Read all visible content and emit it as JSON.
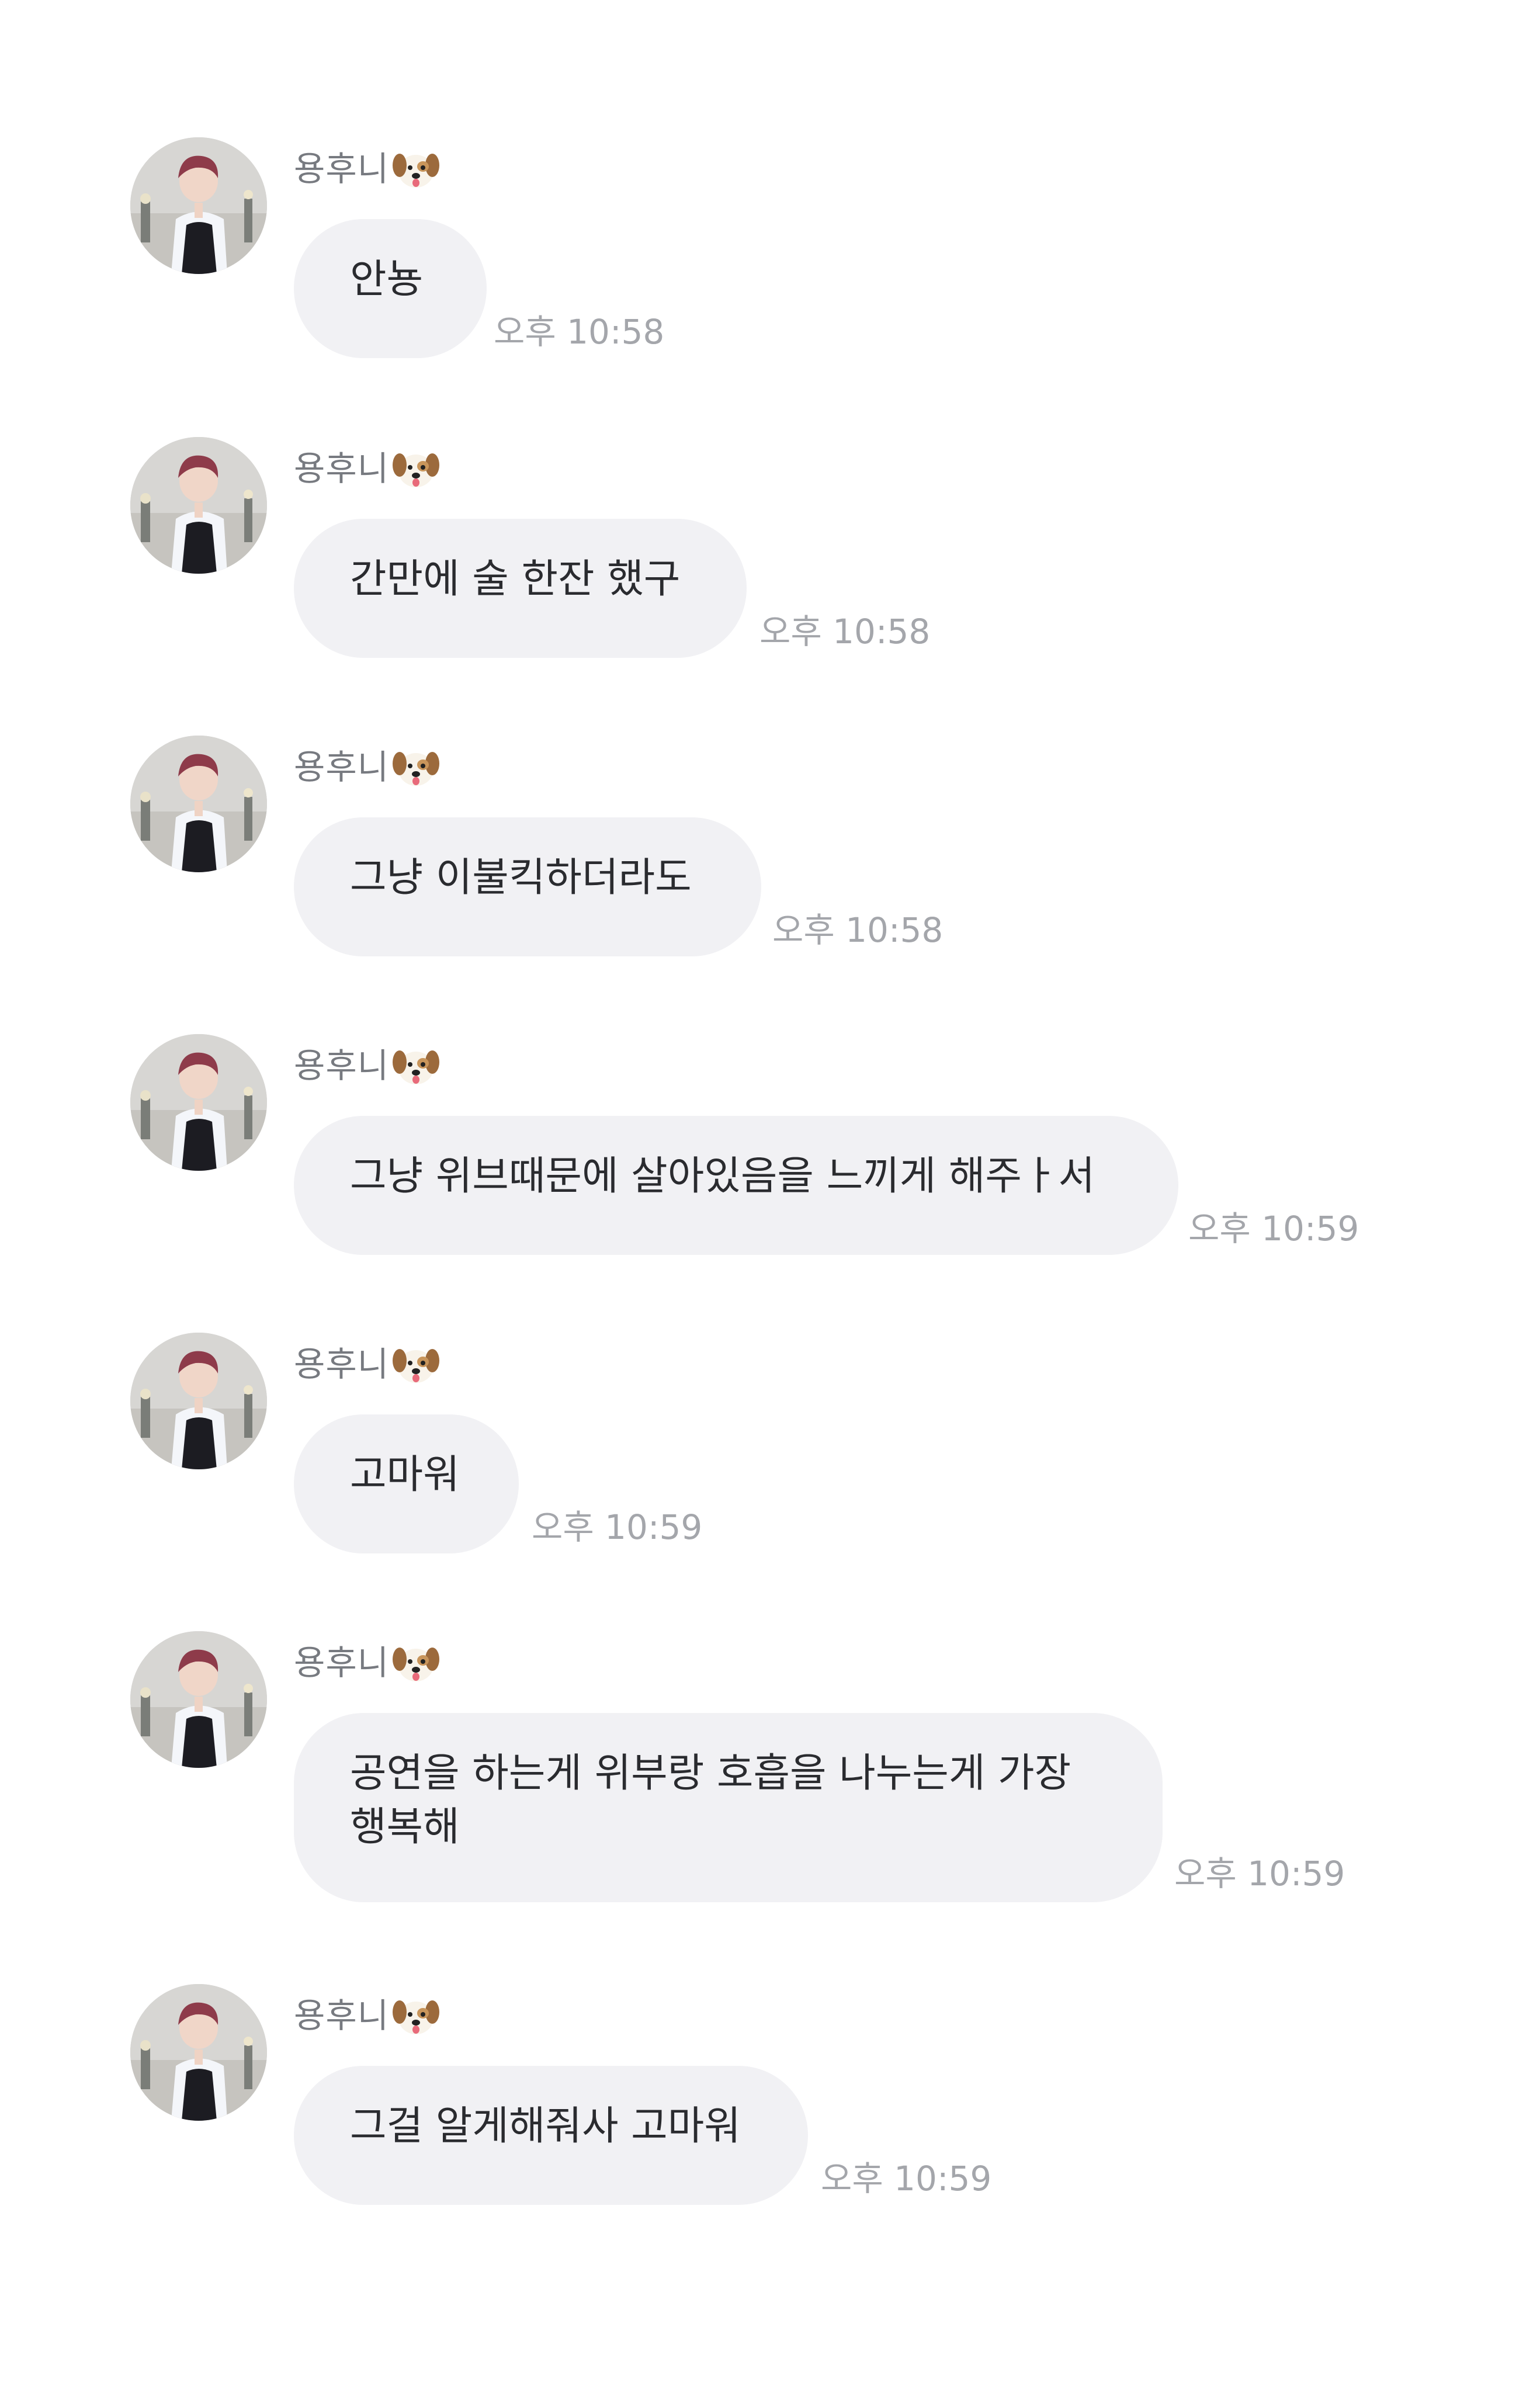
{
  "messages": [
    {
      "sender": "용후니",
      "text": "안뇽",
      "time": "오후 10:58"
    },
    {
      "sender": "용후니",
      "text": "간만에 술 한잔 했구",
      "time": "오후 10:58"
    },
    {
      "sender": "용후니",
      "text": "그냥 이불킥하더라도",
      "time": "오후 10:58"
    },
    {
      "sender": "용후니",
      "text": "그냥 위브때문에 살아있음을 느끼게 해주ㅏ서",
      "time": "오후 10:59"
    },
    {
      "sender": "용후니",
      "text": "고마워",
      "time": "오후 10:59"
    },
    {
      "sender": "용후니",
      "text": "공연을 하는게 위부랑 호흡을 나누는게 가장\n행복해",
      "time": "오후 10:59"
    },
    {
      "sender": "용후니",
      "text": "그걸 알게해줘사 고마워",
      "time": "오후 10:59"
    }
  ],
  "icons": {
    "sender_emoji": "dog-face-icon",
    "avatar": "profile-photo"
  },
  "colors": {
    "bubble": "#f1f1f4",
    "text": "#2a2b2f",
    "sender": "#777a80",
    "time": "#a4a6ab",
    "background": "#ffffff"
  }
}
